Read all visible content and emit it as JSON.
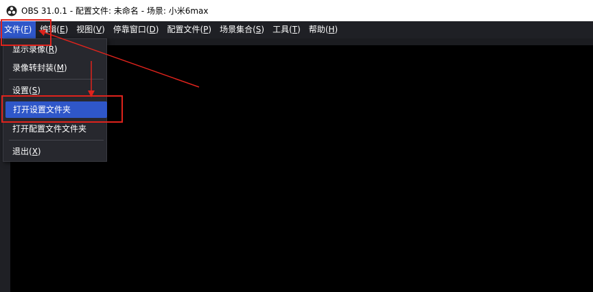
{
  "window": {
    "title": "OBS 31.0.1 - 配置文件: 未命名 - 场景: 小米6max"
  },
  "menubar": {
    "items": [
      {
        "label": "文件(",
        "key": "F",
        "close": ")"
      },
      {
        "label": "编辑(",
        "key": "E",
        "close": ")"
      },
      {
        "label": "视图(",
        "key": "V",
        "close": ")"
      },
      {
        "label": "停靠窗口(",
        "key": "D",
        "close": ")"
      },
      {
        "label": "配置文件(",
        "key": "P",
        "close": ")"
      },
      {
        "label": "场景集合(",
        "key": "S",
        "close": ")"
      },
      {
        "label": "工具(",
        "key": "T",
        "close": ")"
      },
      {
        "label": "帮助(",
        "key": "H",
        "close": ")"
      }
    ]
  },
  "file_menu": {
    "items": [
      {
        "label": "显示录像(",
        "key": "R",
        "close": ")"
      },
      {
        "label": "录像转封装(",
        "key": "M",
        "close": ")"
      },
      {
        "label": "设置(",
        "key": "S",
        "close": ")"
      },
      {
        "label": "打开设置文件夹",
        "key": "",
        "close": ""
      },
      {
        "label": "打开配置文件文件夹",
        "key": "",
        "close": ""
      },
      {
        "label": "退出(",
        "key": "X",
        "close": ")"
      }
    ]
  },
  "colors": {
    "accent": "#2f57c9",
    "annotation": "#e0231c",
    "menubar_bg": "#1f2025",
    "dropdown_bg": "#27282e"
  },
  "icons": {
    "app": "obs-logo-icon"
  }
}
